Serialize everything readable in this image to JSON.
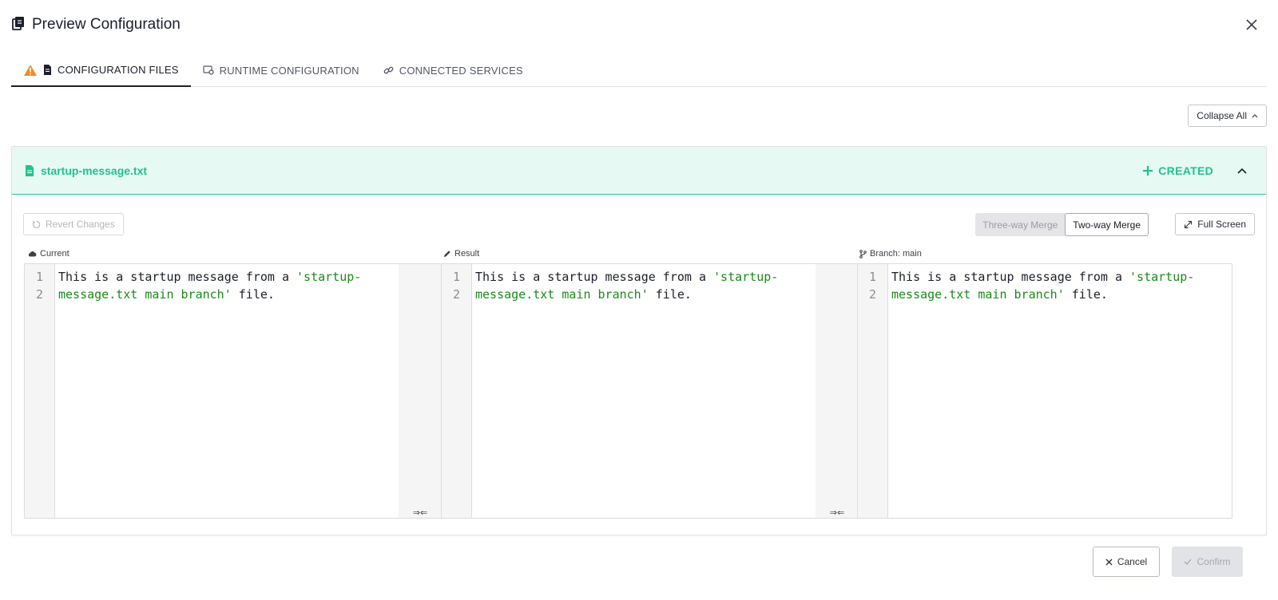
{
  "dialog": {
    "title": "Preview Configuration",
    "close_icon": "close-icon"
  },
  "tabs": [
    {
      "label": "CONFIGURATION FILES",
      "active": true,
      "icons": [
        "warning-icon",
        "file-icon"
      ]
    },
    {
      "label": "RUNTIME CONFIGURATION",
      "active": false,
      "icons": [
        "runtime-settings-icon"
      ]
    },
    {
      "label": "CONNECTED SERVICES",
      "active": false,
      "icons": [
        "link-icon"
      ]
    }
  ],
  "toolbar": {
    "collapse_all_label": "Collapse All"
  },
  "file": {
    "name": "startup-message.txt",
    "status": "CREATED",
    "status_color": "#1ec48c",
    "revert_label": "Revert Changes",
    "merge_modes": [
      {
        "label": "Three-way Merge",
        "active": false
      },
      {
        "label": "Two-way Merge",
        "active": true
      }
    ],
    "fullscreen_label": "Full Screen",
    "columns": [
      {
        "label": "Current",
        "icon": "cloud-icon",
        "lines": [
          "1",
          "2"
        ],
        "code_plain_1": "This is a startup message from a ",
        "code_str_1": "'startup-",
        "code_str_2": "message.txt main branch'",
        "code_plain_2": " file."
      },
      {
        "label": "Result",
        "icon": "pencil-icon",
        "lines": [
          "1",
          "2"
        ],
        "code_plain_1": "This is a startup message from a ",
        "code_str_1": "'startup-",
        "code_str_2": "message.txt main branch'",
        "code_plain_2": " file."
      },
      {
        "label": "Branch: main",
        "icon": "branch-icon",
        "lines": [
          "1",
          "2"
        ],
        "code_plain_1": "This is a startup message from a ",
        "code_str_1": "'startup-",
        "code_str_2": "message.txt main branch'",
        "code_plain_2": " file."
      }
    ],
    "merge_arrow_glyph": "⇒⇐"
  },
  "footer": {
    "cancel_label": "Cancel",
    "confirm_label": "Confirm"
  },
  "colors": {
    "accent_green": "#1ec48c",
    "header_bg": "#e6f9f2",
    "warning": "#f08b2e"
  }
}
